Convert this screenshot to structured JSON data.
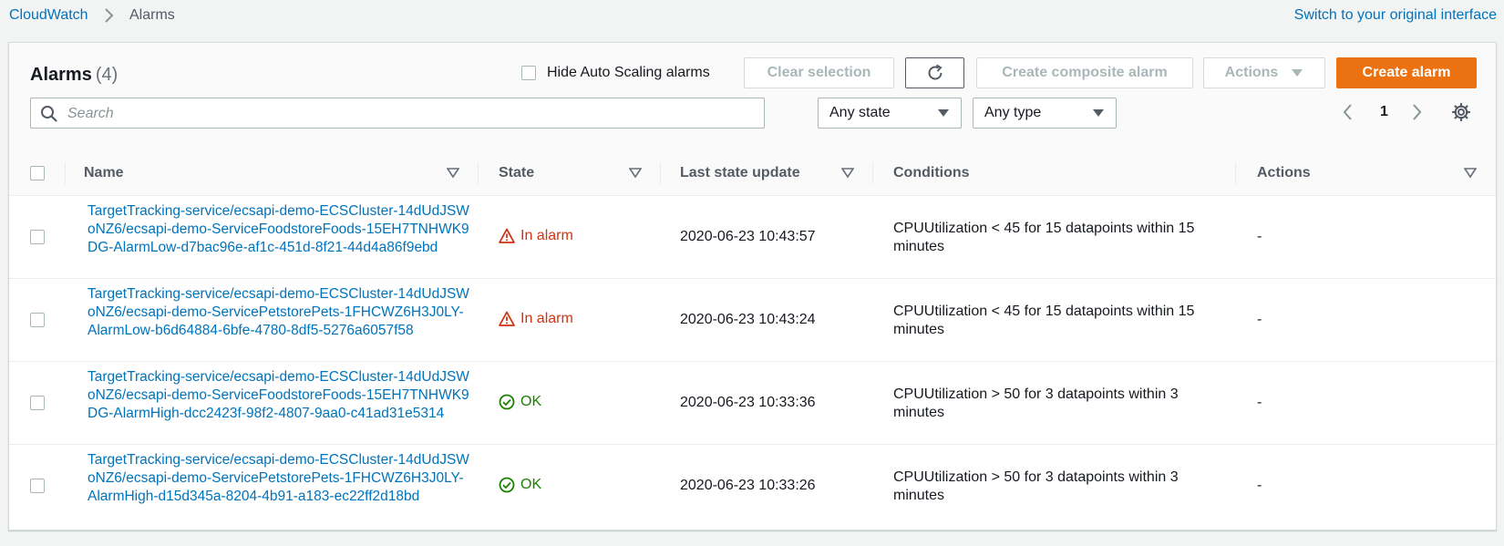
{
  "breadcrumb": {
    "root": "CloudWatch",
    "current": "Alarms"
  },
  "switch_link": "Switch to your original interface",
  "panel": {
    "title": "Alarms",
    "count": "(4)",
    "hide_autoscaling_label": "Hide Auto Scaling alarms",
    "clear_selection": "Clear selection",
    "create_composite": "Create composite alarm",
    "actions": "Actions",
    "create_alarm": "Create alarm",
    "search_placeholder": "Search",
    "state_filter": "Any state",
    "type_filter": "Any type",
    "page": "1"
  },
  "columns": {
    "name": "Name",
    "state": "State",
    "last_update": "Last state update",
    "conditions": "Conditions",
    "actions": "Actions"
  },
  "rows": [
    {
      "name": "TargetTracking-service/ecsapi-demo-ECSCluster-14dUdJSWoNZ6/ecsapi-demo-ServiceFoodstoreFoods-15EH7TNHWK9DG-AlarmLow-d7bac96e-af1c-451d-8f21-44d4a86f9ebd",
      "state": "In alarm",
      "updated": "2020-06-23 10:43:57",
      "conditions": "CPUUtilization < 45 for 15 datapoints within 15 minutes",
      "actions": "-"
    },
    {
      "name": "TargetTracking-service/ecsapi-demo-ECSCluster-14dUdJSWoNZ6/ecsapi-demo-ServicePetstorePets-1FHCWZ6H3J0LY-AlarmLow-b6d64884-6bfe-4780-8df5-5276a6057f58",
      "state": "In alarm",
      "updated": "2020-06-23 10:43:24",
      "conditions": "CPUUtilization < 45 for 15 datapoints within 15 minutes",
      "actions": "-"
    },
    {
      "name": "TargetTracking-service/ecsapi-demo-ECSCluster-14dUdJSWoNZ6/ecsapi-demo-ServiceFoodstoreFoods-15EH7TNHWK9DG-AlarmHigh-dcc2423f-98f2-4807-9aa0-c41ad31e5314",
      "state": "OK",
      "updated": "2020-06-23 10:33:36",
      "conditions": "CPUUtilization > 50 for 3 datapoints within 3 minutes",
      "actions": "-"
    },
    {
      "name": "TargetTracking-service/ecsapi-demo-ECSCluster-14dUdJSWoNZ6/ecsapi-demo-ServicePetstorePets-1FHCWZ6H3J0LY-AlarmHigh-d15d345a-8204-4b91-a183-ec22ff2d18bd",
      "state": "OK",
      "updated": "2020-06-23 10:33:26",
      "conditions": "CPUUtilization > 50 for 3 datapoints within 3 minutes",
      "actions": "-"
    }
  ],
  "colors": {
    "link": "#0073bb",
    "alarm": "#d13212",
    "ok": "#1d8102",
    "primary": "#ec7211"
  }
}
